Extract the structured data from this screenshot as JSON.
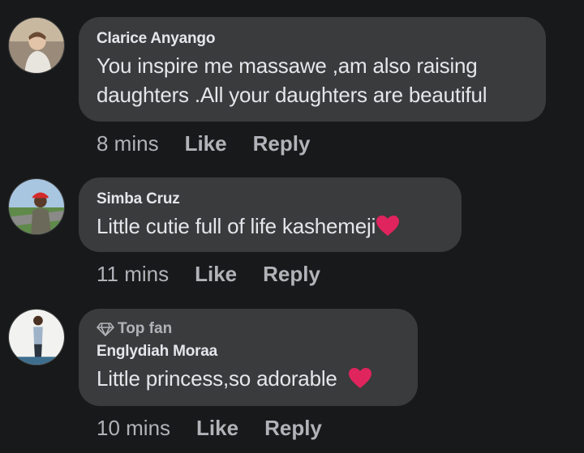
{
  "comments": [
    {
      "author": "Clarice Anyango",
      "badge": "",
      "text": "You inspire me massawe ,am also raising daughters .All your daughters are beautiful",
      "emoji": "",
      "time": "8 mins",
      "like_label": "Like",
      "reply_label": "Reply"
    },
    {
      "author": "Simba Cruz",
      "badge": "",
      "text": "Little cutie full of life kashemeji",
      "emoji": "red-heart",
      "time": "11 mins",
      "like_label": "Like",
      "reply_label": "Reply"
    },
    {
      "author": "Englydiah Moraa",
      "badge": "Top fan",
      "text": "Little princess,so adorable ",
      "emoji": "red-heart",
      "time": "10 mins",
      "like_label": "Like",
      "reply_label": "Reply"
    }
  ],
  "colors": {
    "background": "#18191a",
    "bubble": "#3a3b3c",
    "primary_text": "#e4e6eb",
    "secondary_text": "#b0b3b8",
    "heart": "#e0245e"
  }
}
